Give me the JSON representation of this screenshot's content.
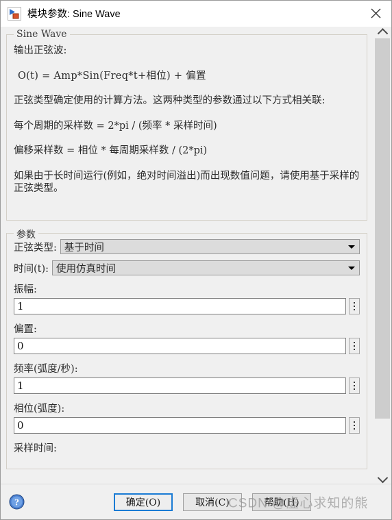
{
  "window": {
    "title": "模块参数: Sine Wave",
    "icon": "simulink-block-icon",
    "close_label": "✕"
  },
  "description": {
    "group_title": "Sine Wave",
    "paragraphs": [
      "输出正弦波:",
      "O(t) = Amp*Sin(Freq*t+相位) + 偏置",
      "正弦类型确定使用的计算方法。这两种类型的参数通过以下方式相关联:",
      "每个周期的采样数 = 2*pi / (频率 * 采样时间)",
      "偏移采样数 = 相位 * 每周期采样数 / (2*pi)",
      "如果由于长时间运行(例如，绝对时间溢出)而出现数值问题，请使用基于采样的正弦类型。"
    ]
  },
  "parameters": {
    "group_title": "参数",
    "sine_type": {
      "label": "正弦类型:",
      "value": "基于时间"
    },
    "time_source": {
      "label": "时间(t):",
      "value": "使用仿真时间"
    },
    "amplitude": {
      "label": "振幅:",
      "value": "1"
    },
    "bias": {
      "label": "偏置:",
      "value": "0"
    },
    "frequency": {
      "label": "频率(弧度/秒):",
      "value": "1"
    },
    "phase": {
      "label": "相位(弧度):",
      "value": "0"
    },
    "sample_time": {
      "label": "采样时间:"
    }
  },
  "scrollbar": {
    "up_arrow": "chevron-up-icon",
    "down_arrow": "chevron-down-icon"
  },
  "footer": {
    "help_icon": "help-circle-icon",
    "ok_label": "确定(O)",
    "cancel_label": "取消(C)",
    "help_label": "帮助(H)",
    "watermark": "CSDN @虚心求知的熊"
  },
  "colors": {
    "accent": "#1a7bd4",
    "window_bg": "#f0f0f0",
    "field_bg": "#ffffff",
    "combo_bg": "#dcdcdc",
    "scroll_thumb": "#cdcdcd"
  }
}
